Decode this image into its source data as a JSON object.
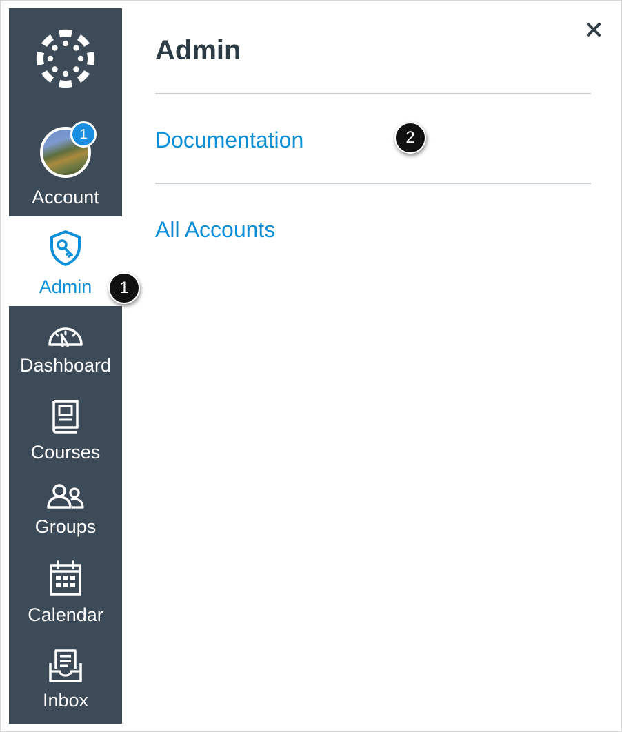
{
  "nav": {
    "account": {
      "label": "Account",
      "badge_count": "1",
      "icon": "user-avatar"
    },
    "admin": {
      "label": "Admin",
      "icon": "shield-key-icon",
      "active": true
    },
    "dashboard": {
      "label": "Dashboard",
      "icon": "speedometer-icon"
    },
    "courses": {
      "label": "Courses",
      "icon": "book-icon"
    },
    "groups": {
      "label": "Groups",
      "icon": "users-icon"
    },
    "calendar": {
      "label": "Calendar",
      "icon": "calendar-icon"
    },
    "inbox": {
      "label": "Inbox",
      "icon": "inbox-icon"
    },
    "logo": {
      "icon": "canvas-logo-icon"
    }
  },
  "tray": {
    "title": "Admin",
    "links": [
      {
        "label": "Documentation"
      },
      {
        "label": "All Accounts"
      }
    ],
    "close_icon": "close-icon"
  },
  "callouts": {
    "first": "1",
    "second": "2"
  },
  "colors": {
    "nav_bg": "#3d4a57",
    "accent": "#0b8fd9",
    "badge": "#1a8fe0",
    "title": "#2d3b45"
  }
}
